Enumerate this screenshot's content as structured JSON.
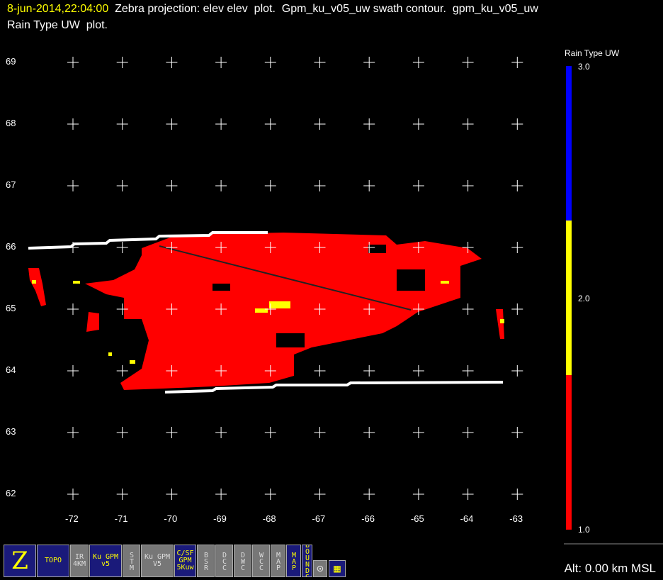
{
  "header": {
    "timestamp": "8-jun-2014,22:04:00",
    "line1": "  Zebra projection: elev elev  plot.  Gpm_ku_v05_uw swath contour.  gpm_ku_v05_uw",
    "line2": "Rain Type UW  plot."
  },
  "axes": {
    "lon_labels": [
      "-72",
      "-71",
      "-70",
      "-69",
      "-68",
      "-67",
      "-66",
      "-65",
      "-64",
      "-63"
    ],
    "lat_labels": [
      "69",
      "68",
      "67",
      "66",
      "65",
      "64",
      "63",
      "62"
    ]
  },
  "colorbar": {
    "title": "Rain Type UW",
    "labels": [
      "3.0",
      "2.0",
      "1.0"
    ],
    "colors": [
      "#0000ff",
      "#ffff00",
      "#ff0000"
    ]
  },
  "toolbar": [
    {
      "name": "zebra",
      "label": "Z",
      "active": true
    },
    {
      "name": "topo",
      "label": "TOPO",
      "active": true
    },
    {
      "name": "ir",
      "label": "IR 4KM",
      "active": false
    },
    {
      "name": "ku-gpm",
      "label": "Ku GPM v5",
      "active": true
    },
    {
      "name": "stm",
      "label": "STM",
      "active": false
    },
    {
      "name": "ku-v5",
      "label": "Ku GPM V5",
      "active": false
    },
    {
      "name": "csf",
      "label": "C/SF GPM 5Kuw",
      "active": true
    },
    {
      "name": "bsr",
      "label": "BSR",
      "active": false
    },
    {
      "name": "dcc",
      "label": "DCC",
      "active": false
    },
    {
      "name": "dwc",
      "label": "DWC",
      "active": false
    },
    {
      "name": "wcc",
      "label": "WCC",
      "active": false
    },
    {
      "name": "map-gray",
      "label": "MAP",
      "active": false
    },
    {
      "name": "map-blue",
      "label": "MAP",
      "active": true
    },
    {
      "name": "bounds",
      "label": "BOUNDS",
      "active": true
    },
    {
      "name": "circle",
      "label": "⊙",
      "active": false
    },
    {
      "name": "grid",
      "label": "▦",
      "active": true
    }
  ],
  "status": {
    "altitude": "Alt: 0.00 km MSL"
  }
}
